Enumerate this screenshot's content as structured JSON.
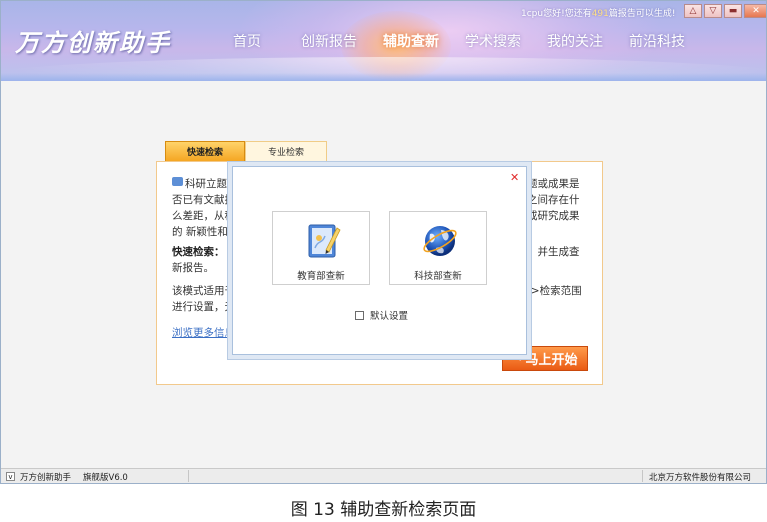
{
  "app": {
    "logo": "万方创新助手",
    "notice_prefix": "1cpu您好!您还有",
    "notice_count": "491",
    "notice_suffix": "篇报告可以生成!"
  },
  "nav": [
    {
      "label": "首页",
      "active": false
    },
    {
      "label": "创新报告",
      "active": false
    },
    {
      "label": "辅助查新",
      "active": true
    },
    {
      "label": "学术搜索",
      "active": false
    },
    {
      "label": "我的关注",
      "active": false
    },
    {
      "label": "前沿科技",
      "active": false
    }
  ],
  "tabs": {
    "quick": "快速检索",
    "pro": "专业检索"
  },
  "panel": {
    "left_para1": [
      "科研立题的",
      "否已有文献报",
      "么差距，从科",
      "的 新颖性和"
    ],
    "right_para1": [
      "题或成果是",
      "之间存在什",
      "或研究成果"
    ],
    "left_para2_title": "快速检索：",
    "left_para2": [
      "新报告。"
    ],
    "right_para2": [
      "，并生成查"
    ],
    "left_para3": [
      "该模式适用于",
      "进行设置，无"
    ],
    "right_para3": [
      "->检索范围"
    ],
    "more_link": "浏览更多信息",
    "start_button": "马上开始"
  },
  "modal": {
    "edu_label": "教育部查新",
    "tech_label": "科技部查新",
    "default_setting": "默认设置"
  },
  "statusbar": {
    "app_name": "万方创新助手",
    "version": "旗舰版V6.0",
    "company": "北京万方软件股份有限公司"
  },
  "caption": "图 13  辅助查新检索页面"
}
